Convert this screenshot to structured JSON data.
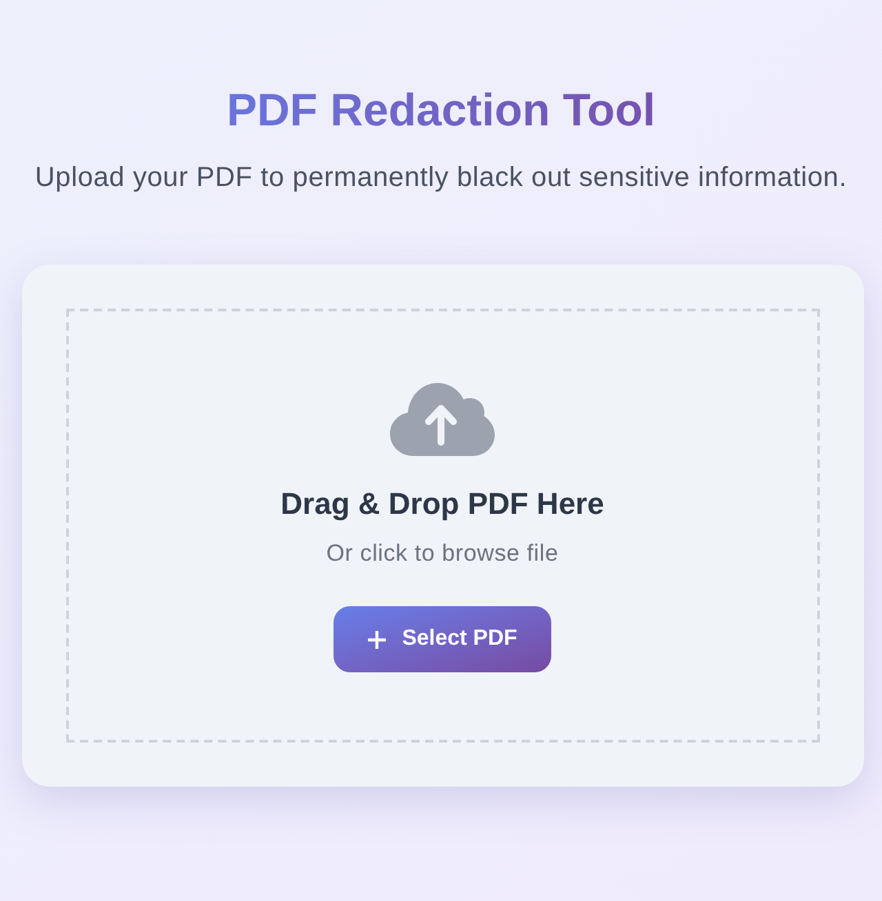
{
  "header": {
    "title": "PDF Redaction Tool",
    "subtitle": "Upload your PDF to permanently black out sensitive information."
  },
  "upload": {
    "heading": "Drag & Drop PDF Here",
    "hint": "Or click to browse file",
    "button": {
      "label": "Select PDF"
    }
  }
}
